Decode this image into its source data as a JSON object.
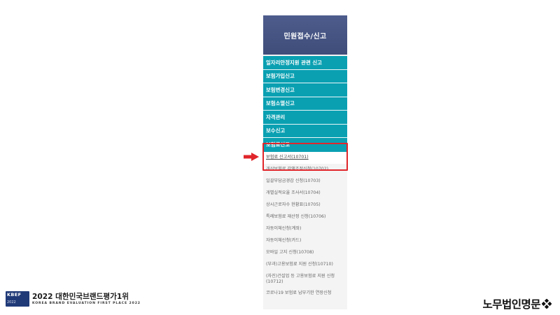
{
  "menu": {
    "title": "민원접수/신고",
    "items": [
      {
        "label": "일자리안정지원 관련 신고"
      },
      {
        "label": "보험가입신고"
      },
      {
        "label": "보험변경신고"
      },
      {
        "label": "보험소멸신고"
      },
      {
        "label": "자격관리"
      },
      {
        "label": "보수신고"
      },
      {
        "label": "보험료신고"
      }
    ],
    "sub_items": [
      {
        "label": "보험료 신고서(10701)"
      },
      {
        "label": "개산보험료 감액조정신청(10702)"
      },
      {
        "label": "일괄부담금경감 신청(10703)"
      },
      {
        "label": "개별실적요율 조사서(10704)"
      },
      {
        "label": "상시근로자수 현황표(10705)"
      },
      {
        "label": "특례보험료 재산정 신청(10706)"
      },
      {
        "label": "자동이체신청(계좌)"
      },
      {
        "label": "자동이체신청(카드)"
      },
      {
        "label": "모바일 고지 신청(10708)"
      },
      {
        "label": "(부과)고용보험료 지원 신청(10710)"
      },
      {
        "label": "(자진)건설업 등 고용보험료 지원 신청(10712)"
      },
      {
        "label": "코로나19 보험료 납부기한 연장신청"
      }
    ]
  },
  "badge": {
    "logo_text": "KBEF",
    "logo_year": "2022",
    "title": "2022 대한민국브랜드평가1위",
    "subtitle": "KOREA BRAND EVALUATION FIRST PLACE 2022"
  },
  "brand": {
    "name": "노무법인명문",
    "mark_icon": "clover-icon"
  },
  "colors": {
    "menu_header": "#46568a",
    "menu_item": "#0aa0b2",
    "highlight": "#e0262b"
  }
}
